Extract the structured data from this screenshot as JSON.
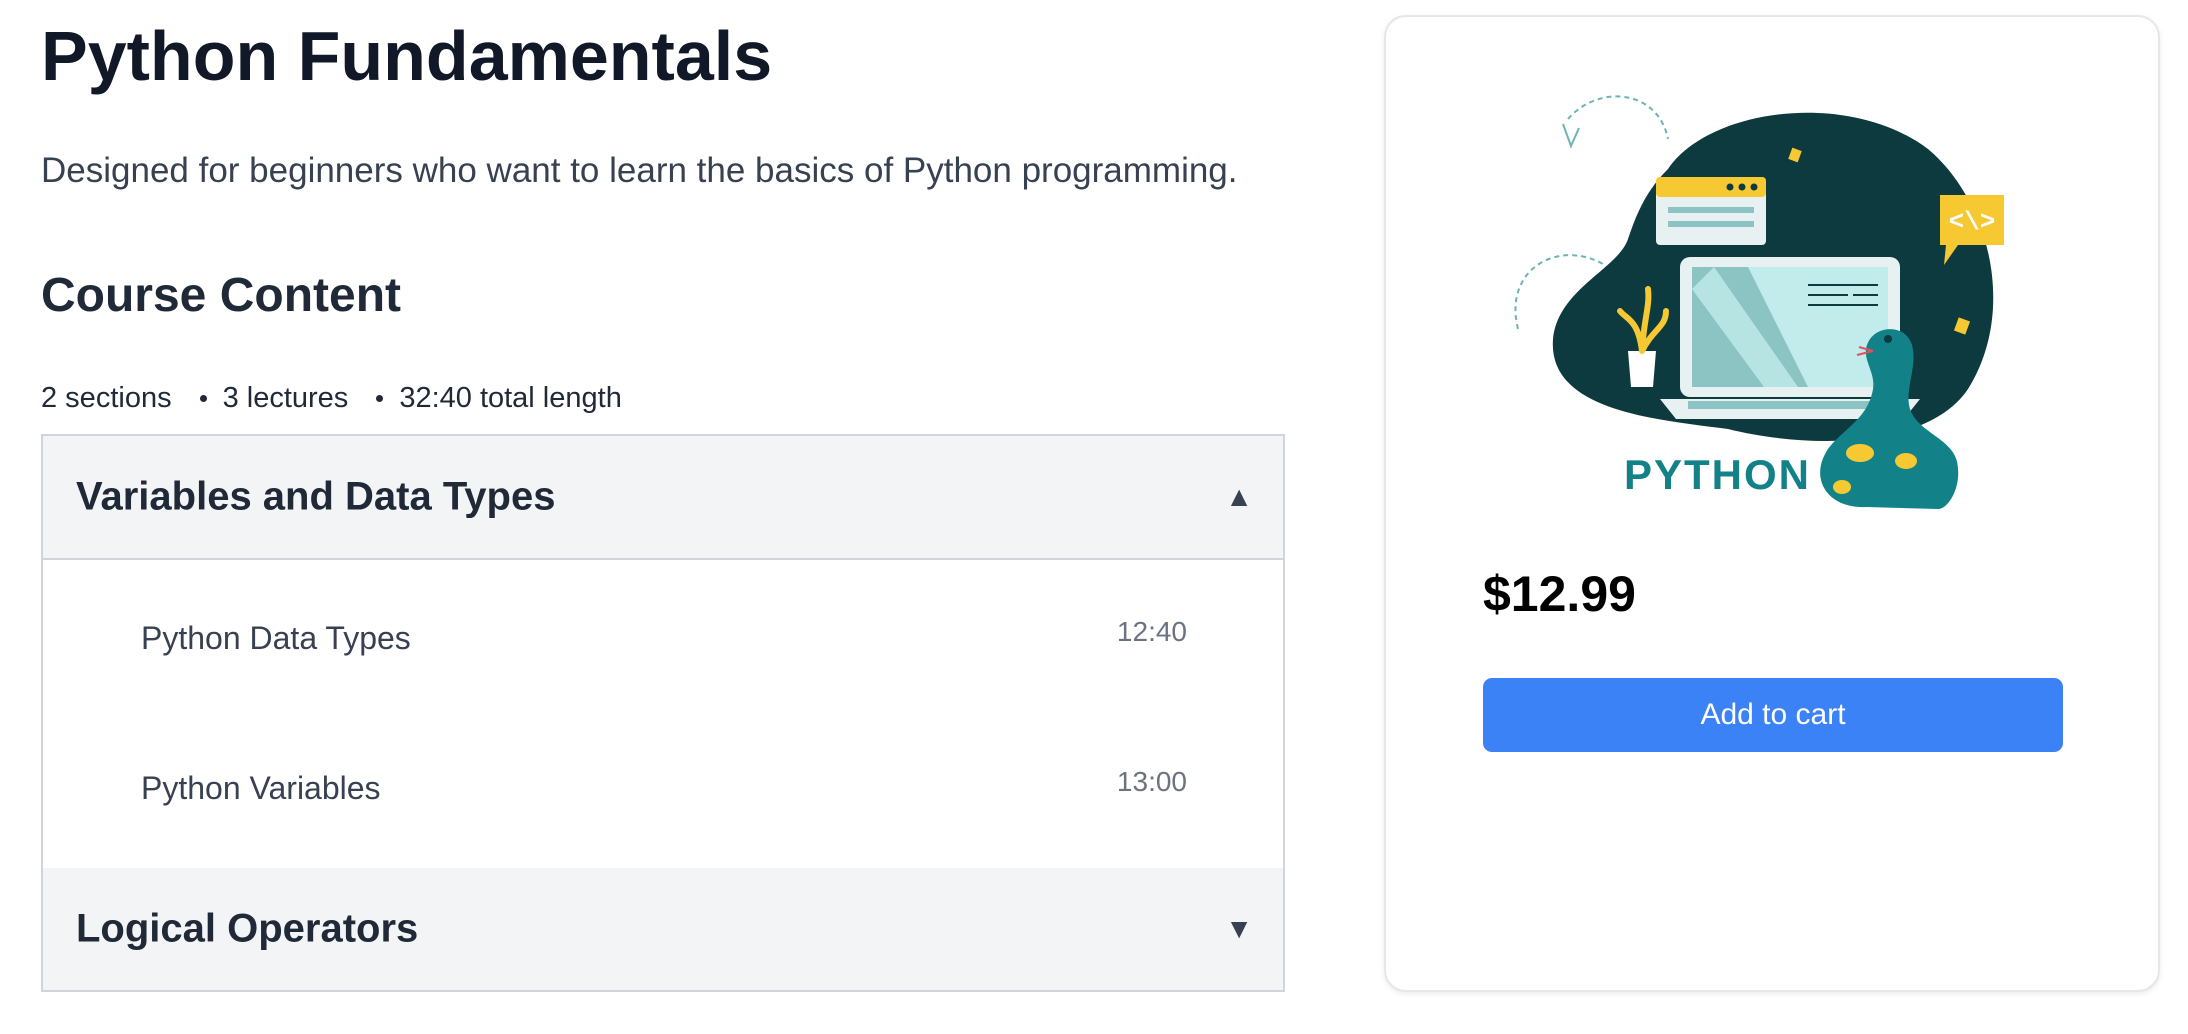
{
  "course": {
    "title": "Python Fundamentals",
    "description": "Designed for beginners who want to learn the basics of Python programming."
  },
  "content": {
    "heading": "Course Content",
    "stats": {
      "sections": "2 sections",
      "lectures": "3 lectures",
      "length": "32:40 total length"
    },
    "sections": [
      {
        "title": "Variables and Data Types",
        "expanded": true,
        "chevron": "▲",
        "lectures": [
          {
            "title": "Python Data Types",
            "duration": "12:40"
          },
          {
            "title": "Python Variables",
            "duration": "13:00"
          }
        ]
      },
      {
        "title": "Logical Operators",
        "expanded": false,
        "chevron": "▼"
      }
    ]
  },
  "purchase": {
    "illustration_text": "PYTHON",
    "price": "$12.99",
    "add_to_cart_label": "Add to cart"
  },
  "colors": {
    "accent": "#3b82f6",
    "illustration_dark": "#0d3a3f",
    "illustration_teal": "#138288",
    "illustration_yellow": "#f6c832",
    "section_header_bg": "#f3f4f6"
  },
  "icons": {
    "expanded": "chevron-up-icon",
    "collapsed": "chevron-down-icon"
  }
}
